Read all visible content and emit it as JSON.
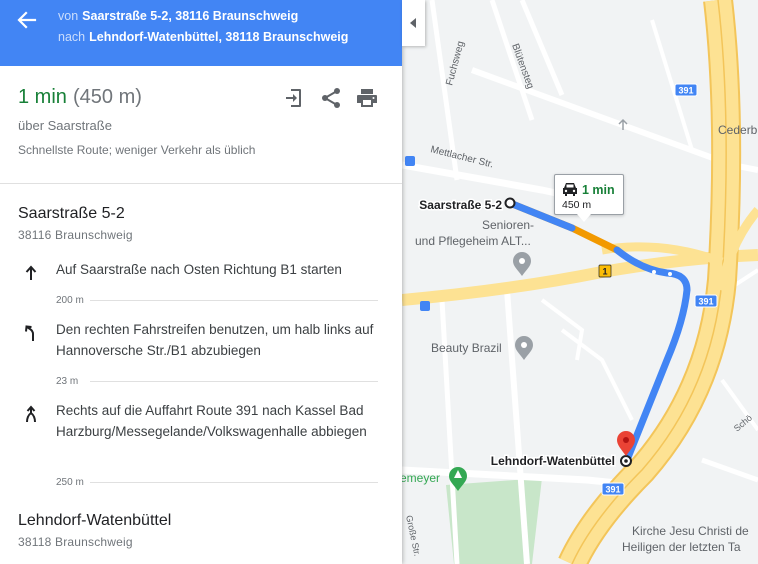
{
  "header": {
    "from_prefix": "von",
    "from_value": "Saarstraße 5-2, 38116 Braunschweig",
    "to_prefix": "nach",
    "to_value": "Lehndorf-Watenbüttel, 38118 Braunschweig"
  },
  "summary": {
    "duration": "1 min",
    "distance": "(450 m)",
    "via": "über Saarstraße",
    "note": "Schnellste Route; weniger Verkehr als üblich"
  },
  "start": {
    "name": "Saarstraße 5-2",
    "postal": "38116 Braunschweig"
  },
  "steps": [
    {
      "icon": "straight-arrow-icon",
      "text": "Auf Saarstraße nach Osten Richtung B1 starten",
      "distance": "200 m"
    },
    {
      "icon": "slight-left-arrow-icon",
      "text": "Den rechten Fahrstreifen benutzen, um halb links auf Hannoversche Str./B1 abzubiegen",
      "distance": "23 m"
    },
    {
      "icon": "ramp-right-icon",
      "text": "Rechts auf die Auffahrt Route 391 nach Kassel Bad Harzburg/Messegelande/Volkswagenhalle abbiegen",
      "distance": "250 m"
    }
  ],
  "end": {
    "name": "Lehndorf-Watenbüttel",
    "postal": "38118 Braunschweig"
  },
  "map": {
    "bubble_time": "1 min",
    "bubble_distance": "450 m",
    "labels": {
      "fuchsweg": "Fuchsweg",
      "bluetensteg": "Blütensteg",
      "mettlacher": "Mettlacher Str.",
      "cederb": "Cederb",
      "saarstrasse": "Saarstraße 5-2",
      "senioren1": "Senioren-",
      "senioren2": "und Pflegeheim ALT...",
      "beauty": "Beauty Brazil",
      "lehndorf": "Lehndorf-Watenbüttel",
      "emeyer": "emeyer",
      "grosse": "Große Str.",
      "kirche1": "Kirche Jesu Christi de",
      "kirche2": "Heiligen der letzten Ta",
      "schoe": "Schö",
      "route391_a": "391",
      "route391_b": "391",
      "route391_c": "391",
      "route1": "1"
    },
    "colors": {
      "route": "#4285f4",
      "route_slow": "#f29900",
      "highway": "#fde293",
      "highway_edge": "#f3c55a",
      "pin": "#ea4335",
      "park_pin": "#34a853",
      "poi_pin": "#9aa0a6"
    }
  }
}
